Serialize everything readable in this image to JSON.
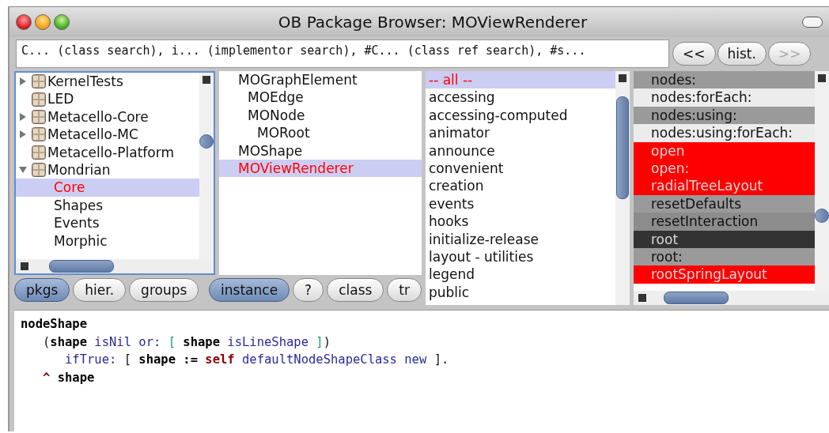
{
  "window": {
    "title": "OB Package Browser: MOViewRenderer"
  },
  "search": {
    "value": "C... (class search), i... (implementor search), #C... (class ref search), #s..."
  },
  "history_buttons": [
    {
      "label": "<<",
      "disabled": false
    },
    {
      "label": "hist.",
      "disabled": false
    },
    {
      "label": ">>",
      "disabled": true
    }
  ],
  "packages": [
    {
      "label": "KernelTests",
      "kind": "expandable",
      "expanded": false,
      "selected": false
    },
    {
      "label": "LED",
      "kind": "plain",
      "selected": false
    },
    {
      "label": "Metacello-Core",
      "kind": "expandable",
      "expanded": false,
      "selected": false
    },
    {
      "label": "Metacello-MC",
      "kind": "expandable",
      "expanded": false,
      "selected": false
    },
    {
      "label": "Metacello-Platform",
      "kind": "plain",
      "selected": false
    },
    {
      "label": "Mondrian",
      "kind": "expandable",
      "expanded": true,
      "selected": false,
      "children": [
        {
          "label": "Core",
          "selected": true
        },
        {
          "label": "Shapes",
          "selected": false
        },
        {
          "label": "Events",
          "selected": false
        },
        {
          "label": "Morphic",
          "selected": false
        }
      ]
    }
  ],
  "classes": [
    {
      "label": "MOGraphElement",
      "selected": false,
      "children": [
        {
          "label": "MOEdge",
          "selected": false
        },
        {
          "label": "MONode",
          "selected": false,
          "children": [
            {
              "label": "MORoot",
              "selected": false
            }
          ]
        }
      ]
    },
    {
      "label": "MOShape",
      "selected": false
    },
    {
      "label": "MOViewRenderer",
      "selected": true
    }
  ],
  "package_buttons": [
    {
      "label": "pkgs",
      "selected": true
    },
    {
      "label": "hier.",
      "selected": false
    },
    {
      "label": "groups",
      "selected": false
    }
  ],
  "class_buttons": [
    {
      "label": "instance",
      "selected": true
    },
    {
      "label": "?",
      "selected": false
    },
    {
      "label": "class",
      "selected": false
    },
    {
      "label": "tr",
      "selected": false
    }
  ],
  "protocols": [
    {
      "label": "-- all --",
      "selected": true
    },
    {
      "label": "accessing",
      "selected": false
    },
    {
      "label": "accessing-computed",
      "selected": false
    },
    {
      "label": "animator",
      "selected": false
    },
    {
      "label": "announce",
      "selected": false
    },
    {
      "label": "convenient",
      "selected": false
    },
    {
      "label": "creation",
      "selected": false
    },
    {
      "label": "events",
      "selected": false
    },
    {
      "label": "hooks",
      "selected": false
    },
    {
      "label": "initialize-release",
      "selected": false
    },
    {
      "label": "layout - utilities",
      "selected": false
    },
    {
      "label": "legend",
      "selected": false
    },
    {
      "label": "public",
      "selected": false
    }
  ],
  "methods": [
    {
      "label": "nodes:",
      "color": "#9a9a9a"
    },
    {
      "label": "nodes:forEach:",
      "color": "#ececec"
    },
    {
      "label": "nodes:using:",
      "color": "#9a9a9a"
    },
    {
      "label": "nodes:using:forEach:",
      "color": "#ececec"
    },
    {
      "label": "open",
      "color": "#ff0000"
    },
    {
      "label": "open:",
      "color": "#ff0000"
    },
    {
      "label": "radialTreeLayout",
      "color": "#ff0000"
    },
    {
      "label": "resetDefaults",
      "color": "#9a9a9a"
    },
    {
      "label": "resetInteraction",
      "color": "#8c8c8c"
    },
    {
      "label": "root",
      "color": "#333333"
    },
    {
      "label": "root:",
      "color": "#9a9a9a"
    },
    {
      "label": "rootSpringLayout",
      "color": "#ff0000"
    }
  ],
  "code": [
    [
      {
        "kind": "bold",
        "text": "nodeShape"
      }
    ],
    [
      {
        "kind": "plain",
        "text": "   ("
      },
      {
        "kind": "bold",
        "text": "shape"
      },
      {
        "kind": "message",
        "text": " isNil or: "
      },
      {
        "kind": "bracket",
        "text": "["
      },
      {
        "kind": "bold",
        "text": " shape"
      },
      {
        "kind": "message",
        "text": " isLineShape "
      },
      {
        "kind": "bracket",
        "text": "]"
      },
      {
        "kind": "plain",
        "text": ")"
      }
    ],
    [
      {
        "kind": "message",
        "text": "      ifTrue: "
      },
      {
        "kind": "plain",
        "text": "[ "
      },
      {
        "kind": "bold",
        "text": "shape :="
      },
      {
        "kind": "self",
        "text": " self"
      },
      {
        "kind": "message",
        "text": " defaultNodeShapeClass new "
      },
      {
        "kind": "plain",
        "text": "]."
      }
    ],
    [
      {
        "kind": "self",
        "text": "   ^ "
      },
      {
        "kind": "bold",
        "text": "shape"
      }
    ]
  ]
}
